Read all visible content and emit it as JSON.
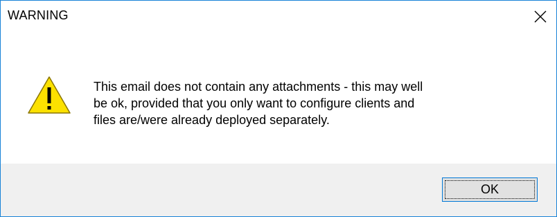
{
  "window": {
    "title": "WARNING"
  },
  "icons": {
    "close": "close-icon",
    "warning": "warning-icon"
  },
  "message": {
    "lines": [
      "This email does not contain any attachments - this may well",
      "be ok, provided that you only want to configure clients and",
      "files are/were already deployed separately."
    ]
  },
  "buttons": {
    "ok_label": "OK"
  },
  "colors": {
    "border": "#1883d7",
    "footer_bg": "#f0f0f0",
    "warning_fill": "#fce100",
    "button_bg": "#e1e1e1",
    "button_border": "#0078d7"
  }
}
